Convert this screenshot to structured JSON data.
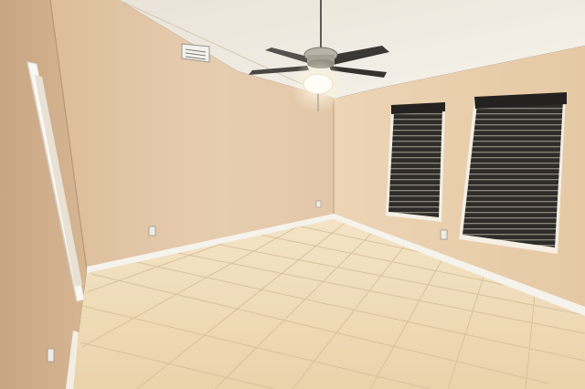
{
  "scene": {
    "description_tag": "empty-room-photo",
    "palette": {
      "wall_warm": "#e4c8a6",
      "wall_shadow": "#c9a884",
      "ceiling": "#f2ede4",
      "floor_tile": "#efdcb8",
      "grout": "#d6be98",
      "baseboard": "#f4f1ea",
      "blind": "#2b2a28"
    },
    "objects": {
      "ceiling_fan": "ceiling-fan",
      "windows": [
        "window-left",
        "window-right"
      ],
      "door": "open-doorway",
      "vent": "ceiling-vent",
      "outlets": [
        "outlet-back-wall",
        "outlet-right-wall",
        "outlet-left-wall"
      ]
    }
  }
}
